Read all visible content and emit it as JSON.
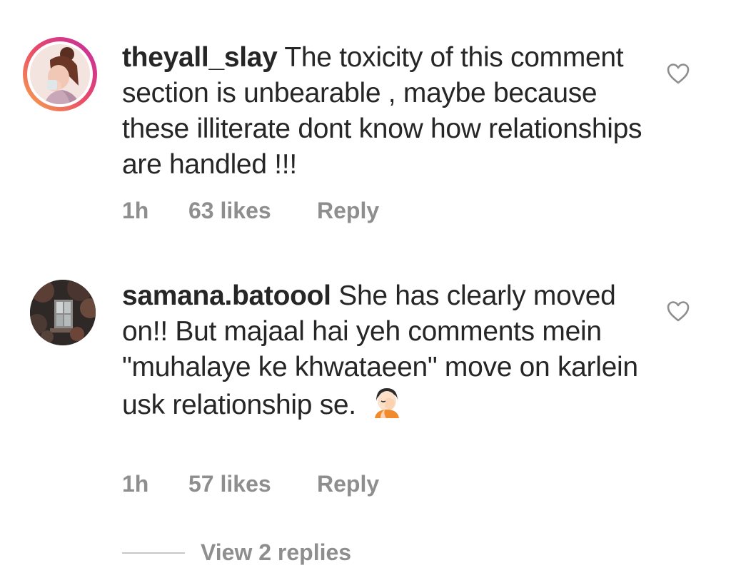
{
  "comments": [
    {
      "username": "theyall_slay",
      "text": "The toxicity of this comment section is unbearable , maybe because these illiterate dont know how relationships are handled !!!",
      "time": "1h",
      "likes": "63 likes",
      "reply_label": "Reply",
      "avatar_icon": "profile-photo-avatar",
      "has_story_ring": true
    },
    {
      "username": "samana.batoool",
      "text": "She has clearly moved on!! But majaal hai yeh comments mein \"muhalaye ke khwataeen\" move on karlein usk relationship se.",
      "emoji_icon": "woman-facepalming-emoji",
      "time": "1h",
      "likes": "57 likes",
      "reply_label": "Reply",
      "avatar_icon": "profile-photo-avatar",
      "has_story_ring": false
    }
  ],
  "view_replies_label": "View 2 replies",
  "colors": {
    "text": "#262626",
    "secondary": "#8e8e8e",
    "story_ring_start": "#f9a94a",
    "story_ring_end": "#c32aa3"
  }
}
